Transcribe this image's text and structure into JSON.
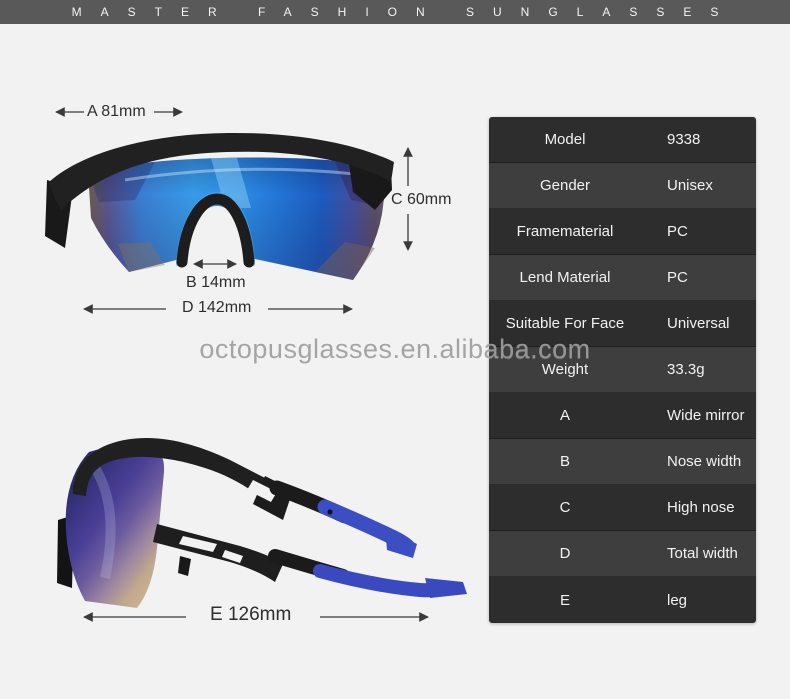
{
  "banner": {
    "title": "MASTER FASHION SUNGLASSES"
  },
  "watermark": {
    "text": "octopusglasses.en.alibaba.com"
  },
  "annotations": {
    "a": "A 81mm",
    "b": "B 14mm",
    "c": "C 60mm",
    "d": "D 142mm",
    "e": "E 126mm"
  },
  "spec_table": {
    "rows": [
      {
        "label": "Model",
        "value": "9338"
      },
      {
        "label": "Gender",
        "value": "Unisex"
      },
      {
        "label": "Framematerial",
        "value": "PC"
      },
      {
        "label": "Lend Material",
        "value": "PC"
      },
      {
        "label": "Suitable For Face",
        "value": "Universal"
      },
      {
        "label": "Weight",
        "value": "33.3g"
      },
      {
        "label": "A",
        "value": "Wide mirror"
      },
      {
        "label": "B",
        "value": "Nose width"
      },
      {
        "label": "C",
        "value": "High nose"
      },
      {
        "label": "D",
        "value": "Total width"
      },
      {
        "label": "E",
        "value": "leg"
      }
    ]
  },
  "colors": {
    "banner_bg": "#595959",
    "page_bg": "#f2f2f2",
    "table_row_dark": "#2d2d2d",
    "table_row_light": "#3e3e3e",
    "table_text": "#f2f2f2",
    "lens_blue": "#2f8fe2",
    "lens_purple": "#4a3f96",
    "temple_blue": "#3b4ec4",
    "frame_black": "#1f1f1f",
    "watermark_gray": "#9e9e9e",
    "annotation_gray": "#3a3a3a"
  }
}
